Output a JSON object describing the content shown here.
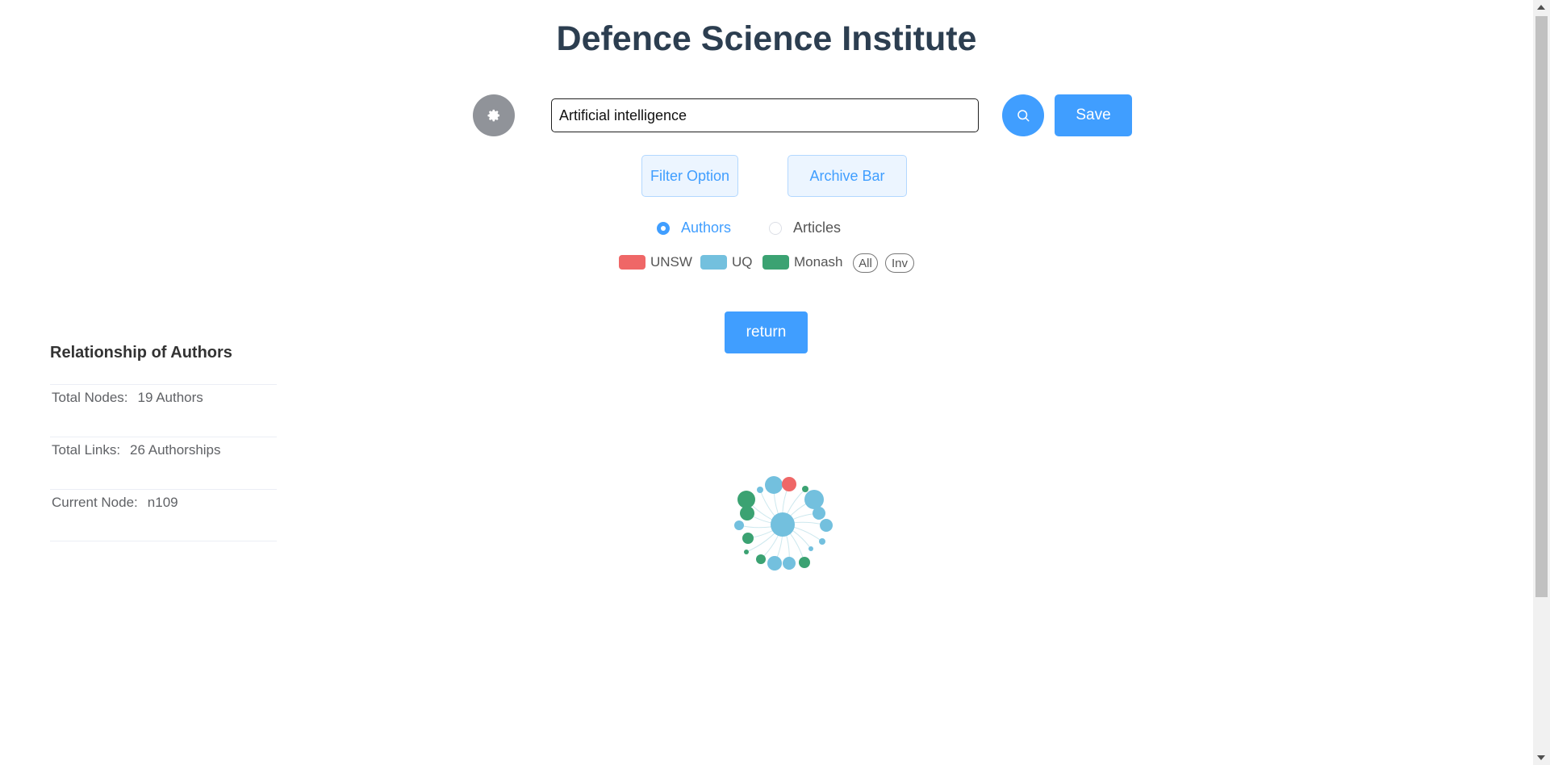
{
  "header": {
    "title": "Defence Science Institute"
  },
  "toolbar": {
    "settings_icon": "gear-icon",
    "search_value": "Artificial intelligence",
    "search_icon": "search-icon",
    "save_label": "Save"
  },
  "options": {
    "filter_label": "Filter Option",
    "archive_label": "Archive Bar"
  },
  "mode": {
    "selected": "Authors",
    "authors_label": "Authors",
    "articles_label": "Articles"
  },
  "legend": {
    "items": [
      {
        "label": "UNSW",
        "color": "#ef6767"
      },
      {
        "label": "UQ",
        "color": "#73c0de"
      },
      {
        "label": "Monash",
        "color": "#3ba272"
      }
    ],
    "all_label": "All",
    "inv_label": "Inv"
  },
  "return_label": "return",
  "sidebar": {
    "title": "Relationship of Authors",
    "rows": [
      {
        "label": "Total Nodes:",
        "value": "19 Authors"
      },
      {
        "label": "Total Links:",
        "value": "26 Authorships"
      },
      {
        "label": "Current Node:",
        "value": "n109"
      }
    ]
  },
  "graph": {
    "link_color": "#cde8ee",
    "nodes": [
      {
        "group": "UQ",
        "center": true
      },
      {
        "group": "UQ"
      },
      {
        "group": "UNSW"
      },
      {
        "group": "Monash"
      },
      {
        "group": "UQ"
      },
      {
        "group": "UQ"
      },
      {
        "group": "UQ"
      },
      {
        "group": "UQ"
      },
      {
        "group": "UQ"
      },
      {
        "group": "Monash"
      },
      {
        "group": "UQ"
      },
      {
        "group": "UQ"
      },
      {
        "group": "Monash"
      },
      {
        "group": "Monash"
      },
      {
        "group": "Monash"
      },
      {
        "group": "UQ"
      },
      {
        "group": "Monash"
      },
      {
        "group": "Monash"
      },
      {
        "group": "UQ"
      },
      {
        "group": "Monash"
      }
    ]
  }
}
